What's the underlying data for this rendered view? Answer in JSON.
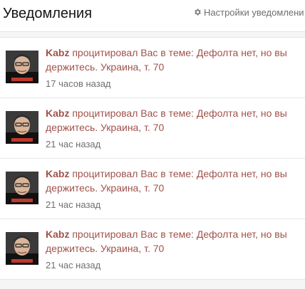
{
  "header": {
    "title": "Уведомления",
    "settings_label": "Настройки уведомлени",
    "settings_icon": "gear-icon"
  },
  "colors": {
    "accent": "#a0524a",
    "muted": "#6f6f6f"
  },
  "notifications": [
    {
      "user": "Kabz",
      "action": " процитировал Вас в теме: ",
      "thread": "Дефолта нет, но вы держитесь. Украина, т. 70",
      "time": "17 часов назад"
    },
    {
      "user": "Kabz",
      "action": " процитировал Вас в теме: ",
      "thread": "Дефолта нет, но вы держитесь. Украина, т. 70",
      "time": "21 час назад"
    },
    {
      "user": "Kabz",
      "action": " процитировал Вас в теме: ",
      "thread": "Дефолта нет, но вы держитесь. Украина, т. 70",
      "time": "21 час назад"
    },
    {
      "user": "Kabz",
      "action": " процитировал Вас в теме: ",
      "thread": "Дефолта нет, но вы держитесь. Украина, т. 70",
      "time": "21 час назад"
    }
  ]
}
